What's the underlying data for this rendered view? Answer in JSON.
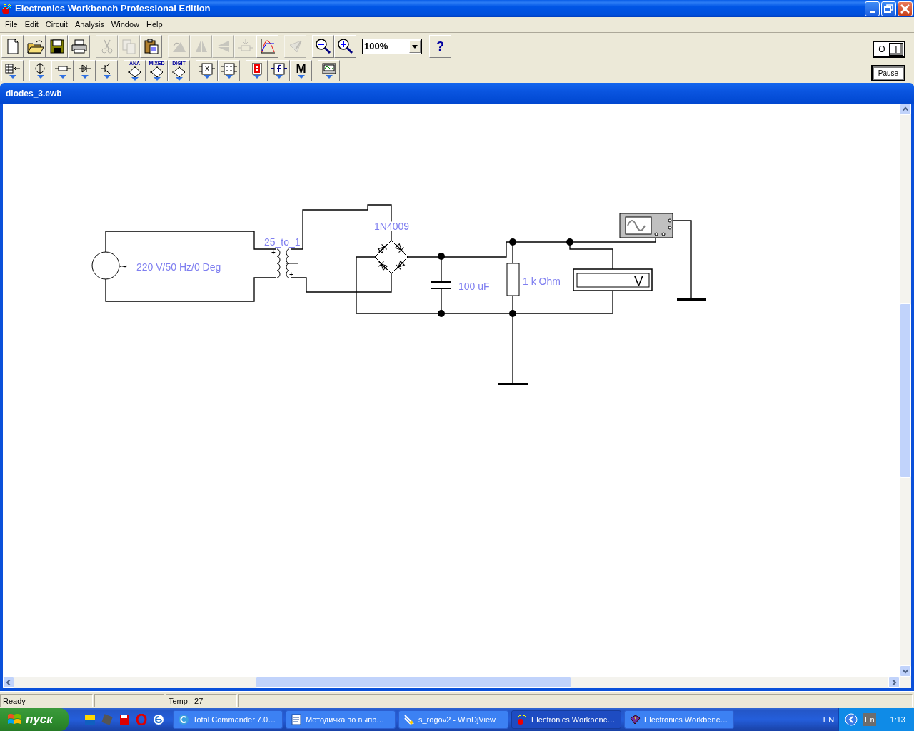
{
  "window": {
    "title": "Electronics Workbench Professional Edition"
  },
  "menu": [
    "File",
    "Edit",
    "Circuit",
    "Analysis",
    "Window",
    "Help"
  ],
  "toolbar": {
    "groups": [
      [
        {
          "disabled": false
        },
        {
          "disabled": false
        },
        {
          "disabled": false
        },
        {
          "disabled": false
        }
      ],
      [
        {
          "disabled": true
        },
        {
          "disabled": true
        },
        {
          "disabled": false
        }
      ],
      [
        {
          "disabled": true
        },
        {
          "disabled": true
        },
        {
          "disabled": true
        },
        {
          "disabled": true
        },
        {
          "disabled": false
        }
      ],
      [
        {
          "disabled": true
        }
      ],
      [
        {
          "disabled": false
        },
        {
          "disabled": false
        }
      ]
    ],
    "zoom": "100%",
    "help": "?"
  },
  "parts_toolbar": {
    "groups": [
      [
        {
          "has_menu": true
        }
      ],
      [
        {
          "has_menu": true
        },
        {
          "has_menu": true
        },
        {
          "has_menu": true
        },
        {
          "has_menu": true
        }
      ],
      [
        {
          "label": "ANA",
          "has_menu": true
        },
        {
          "label": "MIXED",
          "has_menu": true
        },
        {
          "label": "DIGIT",
          "has_menu": true
        }
      ],
      [
        {
          "has_menu": true
        },
        {
          "has_menu": true
        }
      ],
      [
        {
          "has_menu": true
        },
        {
          "has_menu": true
        },
        {
          "label": "M",
          "has_menu": true
        }
      ],
      [
        {
          "has_menu": true
        }
      ]
    ]
  },
  "power_switch": {
    "off_label": "O",
    "on_label": "I",
    "on": true
  },
  "pause_button": "Pause",
  "document": {
    "title": "diodes_3.ewb"
  },
  "circuit": {
    "source": {
      "symbol": "~",
      "label": "220 V/50 Hz/0 Deg"
    },
    "transformer": {
      "label": "25_to_1",
      "polarity_marks": [
        "+",
        "+"
      ]
    },
    "bridge": {
      "label": "1N4009"
    },
    "capacitor": {
      "label": "100 uF"
    },
    "resistor": {
      "label": "1 k Ohm"
    },
    "voltmeter": {
      "unit": "V"
    }
  },
  "status_bar": {
    "message": "Ready",
    "temperature": "Temp:  27"
  },
  "taskbar": {
    "start": "пуск",
    "tasks": [
      {
        "label": "Total Commander 7.0…",
        "selected": false
      },
      {
        "label": "Методичка по выпр…",
        "selected": false
      },
      {
        "label": "s_rogov2 - WinDjView",
        "selected": false
      },
      {
        "label": "Electronics Workbenc…",
        "selected": true
      },
      {
        "label": "Electronics Workbenc…",
        "selected": false
      }
    ],
    "language": "EN",
    "input_language": "En",
    "clock": "1:13"
  }
}
